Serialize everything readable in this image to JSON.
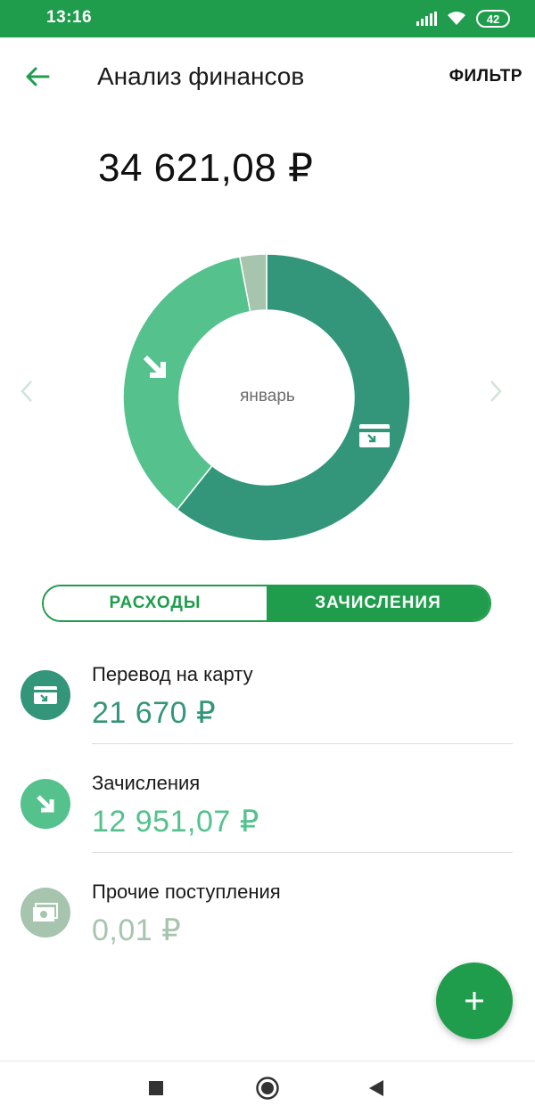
{
  "status_bar": {
    "time": "13:16",
    "battery": "42",
    "icons": [
      "signal-icon",
      "wifi-icon",
      "battery-icon"
    ]
  },
  "header": {
    "title": "Анализ финансов",
    "filter_label": "ФИЛЬТР",
    "back_icon": "arrow-left-icon"
  },
  "total": "34 621,08 ₽",
  "chart_data": {
    "type": "pie",
    "center_label": "январь",
    "labels": [
      "Перевод на карту",
      "Зачисления",
      "Прочие поступления"
    ],
    "values": [
      21670,
      12951.07,
      0.01
    ],
    "colors": [
      "#33967a",
      "#55c28e",
      "#a6c4ae"
    ]
  },
  "tabs": {
    "expenses": "РАСХОДЫ",
    "income": "ЗАЧИСЛЕНИЯ",
    "active": "income"
  },
  "categories": [
    {
      "name": "Перевод на карту",
      "amount": "21 670 ₽",
      "color": "#33967a",
      "icon": "card-transfer-icon"
    },
    {
      "name": "Зачисления",
      "amount": "12 951,07 ₽",
      "color": "#55c28e",
      "icon": "arrow-down-right-icon"
    },
    {
      "name": "Прочие поступления",
      "amount": "0,01 ₽",
      "color": "#a6c4ae",
      "icon": "cash-icon"
    }
  ],
  "colors": {
    "brand": "#1f9d4c",
    "muted_amount": "#a6c4ae"
  }
}
